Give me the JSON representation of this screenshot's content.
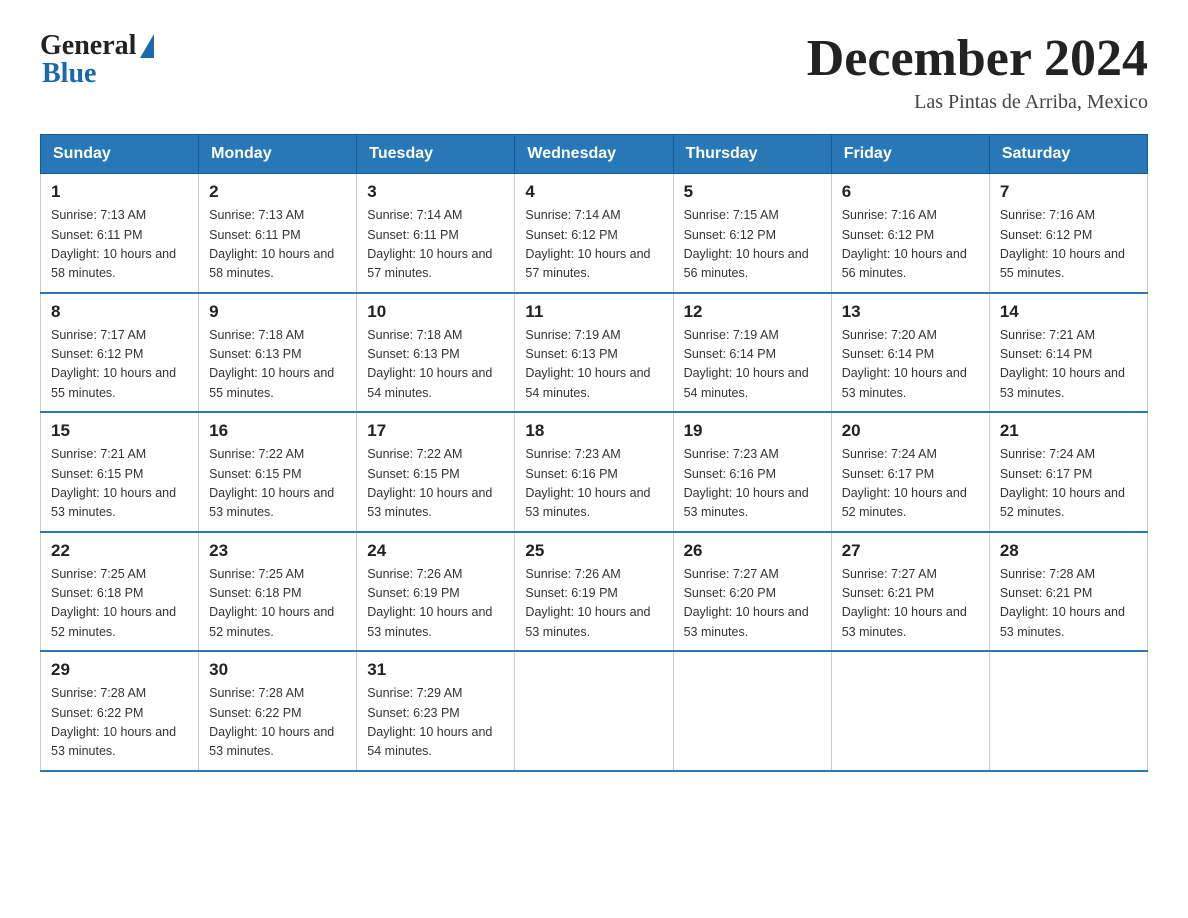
{
  "header": {
    "logo_general": "General",
    "logo_blue": "Blue",
    "month_title": "December 2024",
    "location": "Las Pintas de Arriba, Mexico"
  },
  "weekdays": [
    "Sunday",
    "Monday",
    "Tuesday",
    "Wednesday",
    "Thursday",
    "Friday",
    "Saturday"
  ],
  "weeks": [
    [
      {
        "day": "1",
        "sunrise": "7:13 AM",
        "sunset": "6:11 PM",
        "daylight": "10 hours and 58 minutes."
      },
      {
        "day": "2",
        "sunrise": "7:13 AM",
        "sunset": "6:11 PM",
        "daylight": "10 hours and 58 minutes."
      },
      {
        "day": "3",
        "sunrise": "7:14 AM",
        "sunset": "6:11 PM",
        "daylight": "10 hours and 57 minutes."
      },
      {
        "day": "4",
        "sunrise": "7:14 AM",
        "sunset": "6:12 PM",
        "daylight": "10 hours and 57 minutes."
      },
      {
        "day": "5",
        "sunrise": "7:15 AM",
        "sunset": "6:12 PM",
        "daylight": "10 hours and 56 minutes."
      },
      {
        "day": "6",
        "sunrise": "7:16 AM",
        "sunset": "6:12 PM",
        "daylight": "10 hours and 56 minutes."
      },
      {
        "day": "7",
        "sunrise": "7:16 AM",
        "sunset": "6:12 PM",
        "daylight": "10 hours and 55 minutes."
      }
    ],
    [
      {
        "day": "8",
        "sunrise": "7:17 AM",
        "sunset": "6:12 PM",
        "daylight": "10 hours and 55 minutes."
      },
      {
        "day": "9",
        "sunrise": "7:18 AM",
        "sunset": "6:13 PM",
        "daylight": "10 hours and 55 minutes."
      },
      {
        "day": "10",
        "sunrise": "7:18 AM",
        "sunset": "6:13 PM",
        "daylight": "10 hours and 54 minutes."
      },
      {
        "day": "11",
        "sunrise": "7:19 AM",
        "sunset": "6:13 PM",
        "daylight": "10 hours and 54 minutes."
      },
      {
        "day": "12",
        "sunrise": "7:19 AM",
        "sunset": "6:14 PM",
        "daylight": "10 hours and 54 minutes."
      },
      {
        "day": "13",
        "sunrise": "7:20 AM",
        "sunset": "6:14 PM",
        "daylight": "10 hours and 53 minutes."
      },
      {
        "day": "14",
        "sunrise": "7:21 AM",
        "sunset": "6:14 PM",
        "daylight": "10 hours and 53 minutes."
      }
    ],
    [
      {
        "day": "15",
        "sunrise": "7:21 AM",
        "sunset": "6:15 PM",
        "daylight": "10 hours and 53 minutes."
      },
      {
        "day": "16",
        "sunrise": "7:22 AM",
        "sunset": "6:15 PM",
        "daylight": "10 hours and 53 minutes."
      },
      {
        "day": "17",
        "sunrise": "7:22 AM",
        "sunset": "6:15 PM",
        "daylight": "10 hours and 53 minutes."
      },
      {
        "day": "18",
        "sunrise": "7:23 AM",
        "sunset": "6:16 PM",
        "daylight": "10 hours and 53 minutes."
      },
      {
        "day": "19",
        "sunrise": "7:23 AM",
        "sunset": "6:16 PM",
        "daylight": "10 hours and 53 minutes."
      },
      {
        "day": "20",
        "sunrise": "7:24 AM",
        "sunset": "6:17 PM",
        "daylight": "10 hours and 52 minutes."
      },
      {
        "day": "21",
        "sunrise": "7:24 AM",
        "sunset": "6:17 PM",
        "daylight": "10 hours and 52 minutes."
      }
    ],
    [
      {
        "day": "22",
        "sunrise": "7:25 AM",
        "sunset": "6:18 PM",
        "daylight": "10 hours and 52 minutes."
      },
      {
        "day": "23",
        "sunrise": "7:25 AM",
        "sunset": "6:18 PM",
        "daylight": "10 hours and 52 minutes."
      },
      {
        "day": "24",
        "sunrise": "7:26 AM",
        "sunset": "6:19 PM",
        "daylight": "10 hours and 53 minutes."
      },
      {
        "day": "25",
        "sunrise": "7:26 AM",
        "sunset": "6:19 PM",
        "daylight": "10 hours and 53 minutes."
      },
      {
        "day": "26",
        "sunrise": "7:27 AM",
        "sunset": "6:20 PM",
        "daylight": "10 hours and 53 minutes."
      },
      {
        "day": "27",
        "sunrise": "7:27 AM",
        "sunset": "6:21 PM",
        "daylight": "10 hours and 53 minutes."
      },
      {
        "day": "28",
        "sunrise": "7:28 AM",
        "sunset": "6:21 PM",
        "daylight": "10 hours and 53 minutes."
      }
    ],
    [
      {
        "day": "29",
        "sunrise": "7:28 AM",
        "sunset": "6:22 PM",
        "daylight": "10 hours and 53 minutes."
      },
      {
        "day": "30",
        "sunrise": "7:28 AM",
        "sunset": "6:22 PM",
        "daylight": "10 hours and 53 minutes."
      },
      {
        "day": "31",
        "sunrise": "7:29 AM",
        "sunset": "6:23 PM",
        "daylight": "10 hours and 54 minutes."
      },
      null,
      null,
      null,
      null
    ]
  ]
}
